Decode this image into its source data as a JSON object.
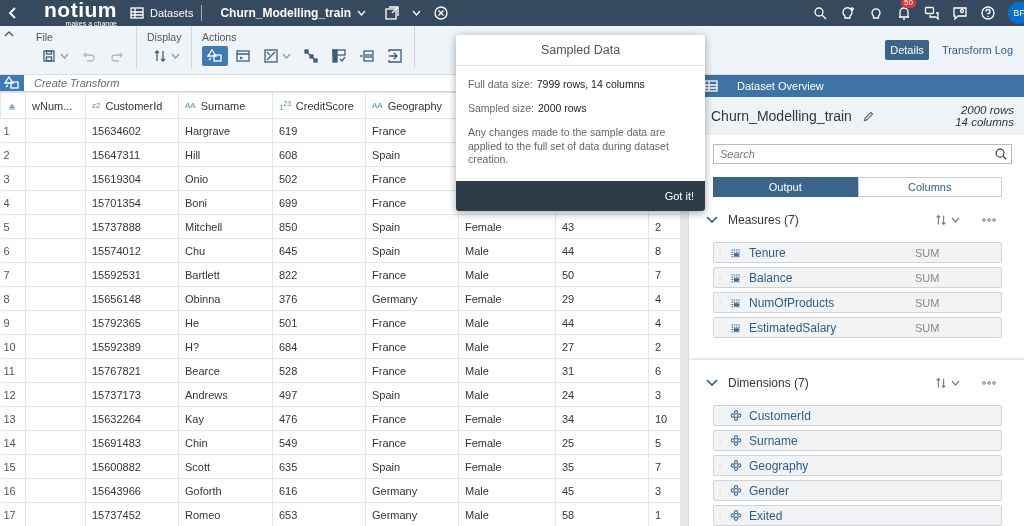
{
  "shell": {
    "logo": "notium",
    "tagline": "makes a change",
    "datasets": "Datasets",
    "title": "Churn_Modelling_train",
    "notifications": "50",
    "avatar": "BF"
  },
  "toolbar": {
    "groups": [
      {
        "label": "File",
        "tools": [
          {
            "kind": "save",
            "menu": true,
            "disabled": false
          },
          {
            "kind": "undo",
            "menu": false,
            "disabled": true
          },
          {
            "kind": "redo",
            "menu": false,
            "disabled": true
          }
        ]
      },
      {
        "label": "Display",
        "tools": [
          {
            "kind": "sort",
            "menu": true
          }
        ]
      },
      {
        "label": "Actions",
        "tools": [
          {
            "kind": "transform",
            "menu": false,
            "selected": true
          },
          {
            "kind": "script",
            "menu": false,
            "selected": false
          },
          {
            "kind": "image",
            "menu": true,
            "selected": false
          },
          {
            "kind": "flow",
            "menu": false,
            "selected": false
          },
          {
            "kind": "split",
            "menu": false,
            "selected": false
          },
          {
            "kind": "align",
            "menu": false,
            "selected": false
          },
          {
            "kind": "import",
            "menu": false,
            "selected": false
          }
        ]
      }
    ]
  },
  "view_tabs": [
    {
      "label": "Details",
      "selected": true
    },
    {
      "label": "Transform Log",
      "selected": false
    }
  ],
  "transform_bar": {
    "placeholder": "Create Transform"
  },
  "table": {
    "columns": [
      {
        "label": "wNum..."
      },
      {
        "label": "CustomerId",
        "icon": "z2"
      },
      {
        "label": "Surname",
        "icon": "AA"
      },
      {
        "label": "CreditScore",
        "icon": "1$^{23}$"
      },
      {
        "label": "Geography",
        "icon": "AA"
      }
    ],
    "rows": [
      {
        "num": "1",
        "cells": [
          "",
          "15634602",
          "Hargrave",
          "619",
          "France"
        ]
      },
      {
        "num": "2",
        "cells": [
          "",
          "15647311",
          "Hill",
          "608",
          "Spain"
        ]
      },
      {
        "num": "3",
        "cells": [
          "",
          "15619304",
          "Onio",
          "502",
          "France"
        ]
      },
      {
        "num": "4",
        "cells": [
          "",
          "15701354",
          "Boni",
          "699",
          "France"
        ]
      },
      {
        "num": "5",
        "cells": [
          "",
          "15737888",
          "Mitchell",
          "850",
          "Spain",
          "Female",
          "43",
          "2"
        ]
      },
      {
        "num": "6",
        "cells": [
          "",
          "15574012",
          "Chu",
          "645",
          "Spain",
          "Male",
          "44",
          "8"
        ]
      },
      {
        "num": "7",
        "cells": [
          "",
          "15592531",
          "Bartlett",
          "822",
          "France",
          "Male",
          "50",
          "7"
        ]
      },
      {
        "num": "8",
        "cells": [
          "",
          "15656148",
          "Obinna",
          "376",
          "Germany",
          "Female",
          "29",
          "4"
        ]
      },
      {
        "num": "9",
        "cells": [
          "",
          "15792365",
          "He",
          "501",
          "France",
          "Male",
          "44",
          "4"
        ]
      },
      {
        "num": "10",
        "cells": [
          "",
          "15592389",
          "H?",
          "684",
          "France",
          "Male",
          "27",
          "2"
        ]
      },
      {
        "num": "11",
        "cells": [
          "",
          "15767821",
          "Bearce",
          "528",
          "France",
          "Male",
          "31",
          "6"
        ]
      },
      {
        "num": "12",
        "cells": [
          "",
          "15737173",
          "Andrews",
          "497",
          "Spain",
          "Male",
          "24",
          "3"
        ]
      },
      {
        "num": "13",
        "cells": [
          "",
          "15632264",
          "Kay",
          "476",
          "France",
          "Female",
          "34",
          "10"
        ]
      },
      {
        "num": "14",
        "cells": [
          "",
          "15691483",
          "Chin",
          "549",
          "France",
          "Female",
          "25",
          "5"
        ]
      },
      {
        "num": "15",
        "cells": [
          "",
          "15600882",
          "Scott",
          "635",
          "Spain",
          "Female",
          "35",
          "7"
        ]
      },
      {
        "num": "16",
        "cells": [
          "",
          "15643966",
          "Goforth",
          "616",
          "Germany",
          "Male",
          "45",
          "3"
        ]
      },
      {
        "num": "17",
        "cells": [
          "",
          "15737452",
          "Romeo",
          "653",
          "Germany",
          "Male",
          "58",
          "1"
        ]
      }
    ]
  },
  "popover": {
    "title": "Sampled Data",
    "facts": [
      {
        "label": "Full data size:",
        "value": "7999 rows, 14 columns"
      },
      {
        "label": "Sampled size:",
        "value": "2000 rows"
      }
    ],
    "note": "Any changes made to the sample data are applied to the full set of data during dataset creation.",
    "button": "Got it!"
  },
  "panel": {
    "header": "Dataset Overview",
    "name": "Churn_Modelling_train",
    "row_count": "2000 rows",
    "column_count": "14 columns",
    "search": {
      "placeholder": "Search"
    },
    "segments": [
      {
        "label": "Output",
        "selected": true
      },
      {
        "label": "Columns",
        "selected": false
      }
    ],
    "sections": [
      {
        "title": "Measures (7)",
        "kind": "measure",
        "expanded": true,
        "items": [
          {
            "name": "Tenure",
            "aggregation": "SUM"
          },
          {
            "name": "Balance",
            "aggregation": "SUM"
          },
          {
            "name": "NumOfProducts",
            "aggregation": "SUM"
          },
          {
            "name": "EstimatedSalary",
            "aggregation": "SUM"
          }
        ]
      },
      {
        "title": "Dimensions (7)",
        "kind": "dimension",
        "expanded": true,
        "items": [
          {
            "name": "CustomerId"
          },
          {
            "name": "Surname"
          },
          {
            "name": "Geography"
          },
          {
            "name": "Gender"
          },
          {
            "name": "Exited"
          }
        ]
      }
    ]
  }
}
